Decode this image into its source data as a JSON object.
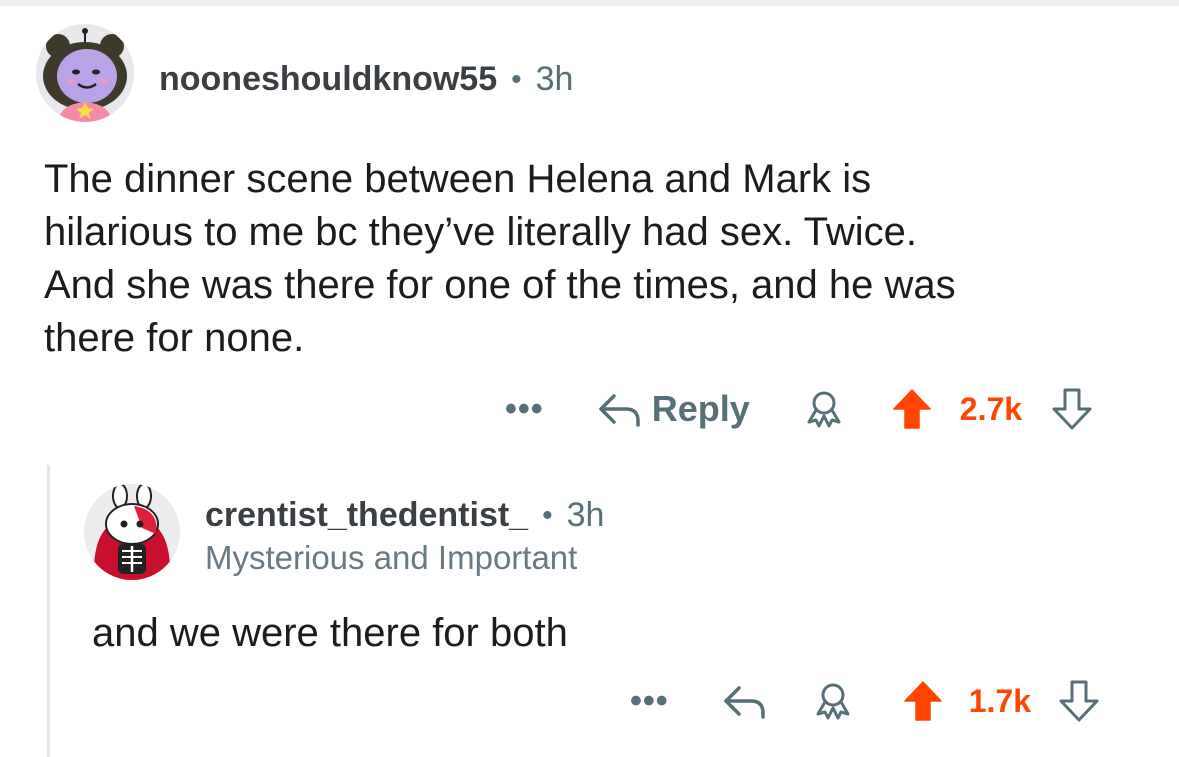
{
  "colors": {
    "upvote": "#ff4500",
    "meta": "#576f76",
    "thread_line": "#e4e6e8"
  },
  "comments": [
    {
      "avatar_icon": "avatar-purple-girl-icon",
      "username": "nooneshouldknow55",
      "separator": "•",
      "time": "3h",
      "body_lines": [
        "The dinner scene between Helena and Mark is",
        "hilarious to me bc they’ve literally had sex. Twice.",
        "And she was there for one of the times, and he was",
        "there for none."
      ],
      "actions": {
        "more": "•••",
        "reply": "Reply",
        "score": "2.7k"
      }
    },
    {
      "avatar_icon": "avatar-skeleton-bunny-icon",
      "username": "crentist_thedentist_",
      "separator": "•",
      "time": "3h",
      "flair": "Mysterious and Important",
      "body": "and we were there for both",
      "actions": {
        "more": "•••",
        "score": "1.7k"
      }
    }
  ]
}
